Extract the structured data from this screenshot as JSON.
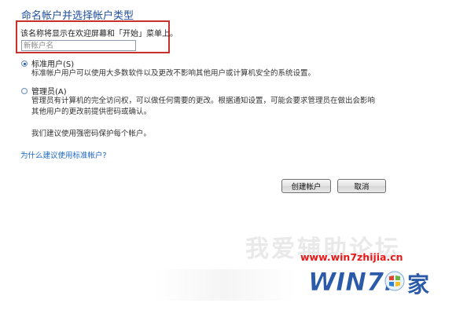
{
  "page": {
    "title": "命名帐户并选择帐户类型",
    "hint": "该名称将显示在欢迎屏幕和「开始」菜单上。"
  },
  "name_field": {
    "value": "",
    "placeholder": "新帐户名"
  },
  "account_types": [
    {
      "label": "标准用户(S)",
      "checked": true,
      "description_lines": [
        "标准帐户用户可以使用大多数软件以及更改不影响其他用户或计算机安全的系统设置。"
      ]
    },
    {
      "label": "管理员(A)",
      "checked": false,
      "description_lines": [
        "管理员有计算机的完全访问权，可以做任何需要的更改。根据通知设置，可能会要求管理员在做出会影响",
        "其他用户的更改前提供密码或确认。",
        "",
        "我们建议使用强密码保护每个帐户。"
      ]
    }
  ],
  "help_link": "为什么建议使用标准帐户?",
  "buttons": {
    "create": "创建帐户",
    "cancel": "取消"
  },
  "watermark": {
    "site_name": "我爱辅助论坛",
    "url": "www.win7zhijia.cn",
    "logo_text": "Win7之家"
  },
  "colors": {
    "title": "#1f4e9c",
    "highlight_border": "#c8312b",
    "link": "#1a66c6",
    "watermark_url": "#ea1a1a"
  }
}
